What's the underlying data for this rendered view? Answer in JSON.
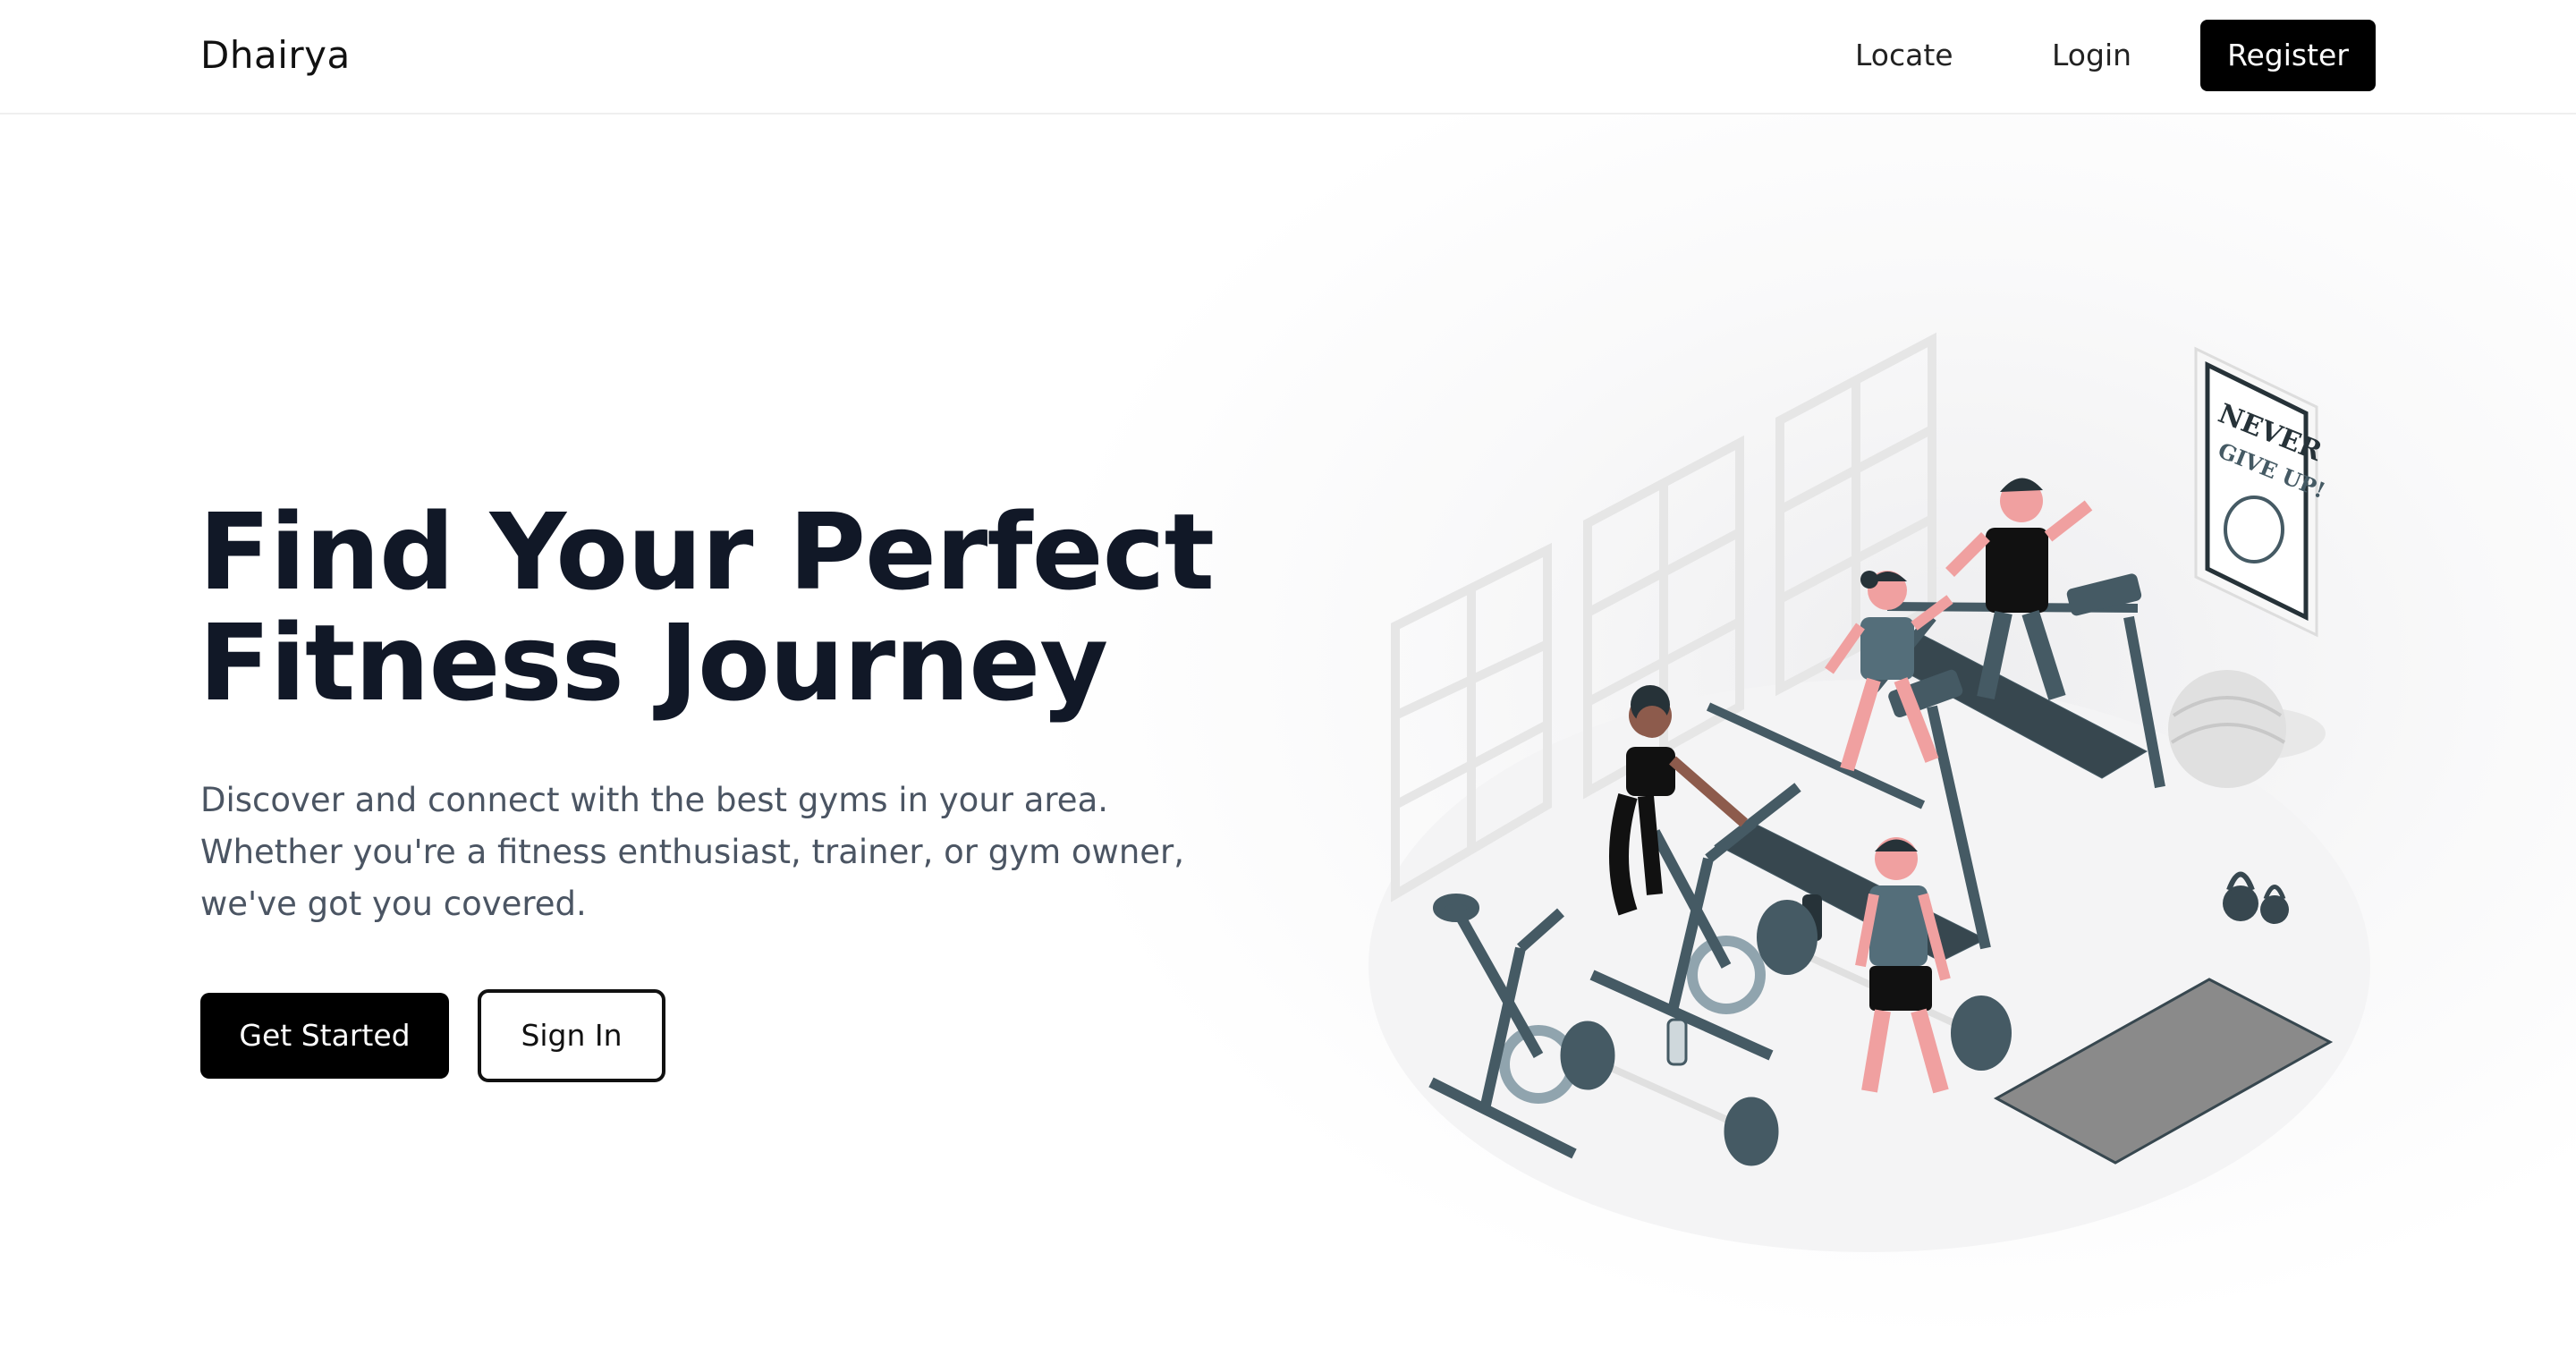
{
  "navbar": {
    "brand": "Dhairya",
    "links": {
      "locate": "Locate",
      "login": "Login",
      "register": "Register"
    }
  },
  "hero": {
    "title_line1": "Find Your Perfect",
    "title_line2": "Fitness Journey",
    "subtitle": "Discover and connect with the best gyms in your area. Whether you're a fitness enthusiast, trainer, or gym owner, we've got you covered.",
    "primary_button": "Get Started",
    "secondary_button": "Sign In"
  },
  "illustration": {
    "poster_line1": "NEVER",
    "poster_line2": "GIVE UP!"
  },
  "colors": {
    "accent": "#000000",
    "heading": "#111827",
    "body_text": "#4b5563",
    "equipment": "#455a64",
    "skin": "#f0a0a0"
  }
}
